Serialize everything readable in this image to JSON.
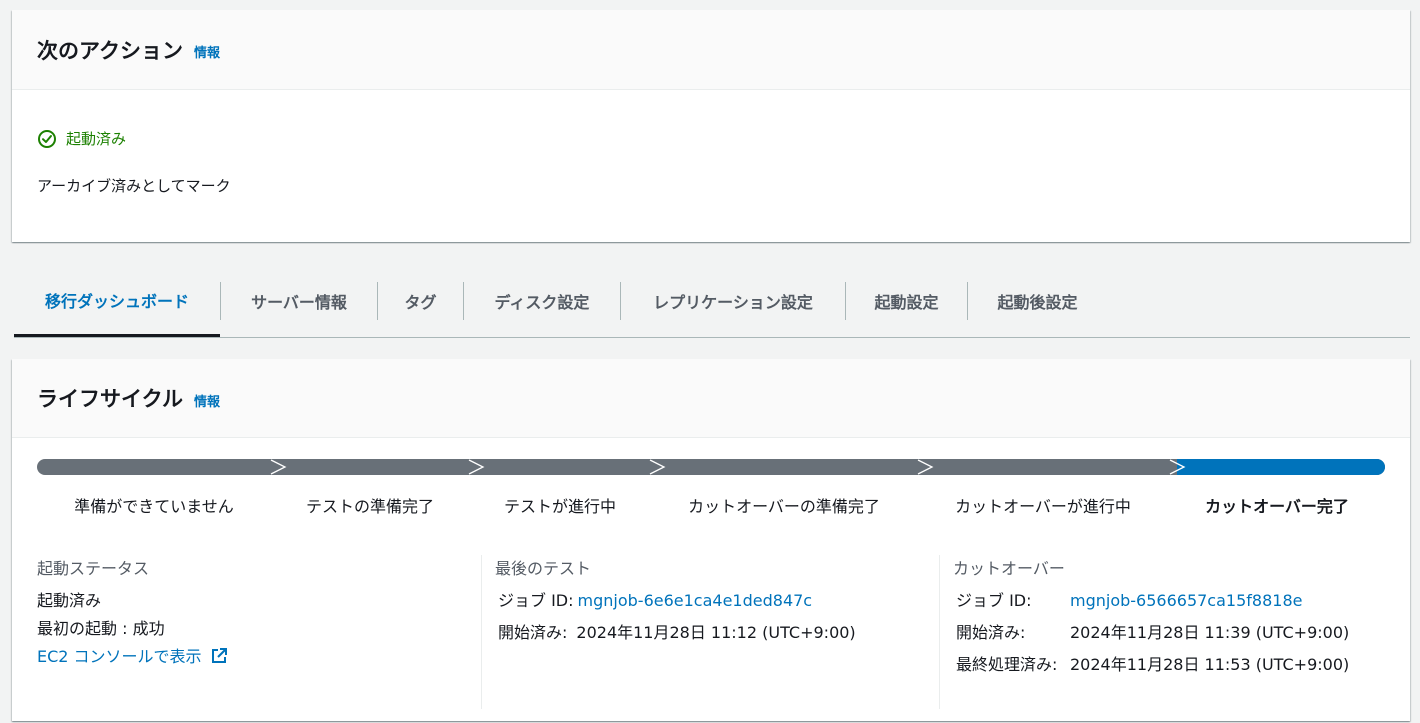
{
  "next_action": {
    "title": "次のアクション",
    "info": "情報",
    "status": "起動済み",
    "status_color": "#1d8102",
    "description": "アーカイブ済みとしてマーク"
  },
  "tabs": [
    {
      "label": "移行ダッシュボード",
      "active": true
    },
    {
      "label": "サーバー情報",
      "active": false
    },
    {
      "label": "タグ",
      "active": false
    },
    {
      "label": "ディスク設定",
      "active": false
    },
    {
      "label": "レプリケーション設定",
      "active": false
    },
    {
      "label": "起動設定",
      "active": false
    },
    {
      "label": "起動後設定",
      "active": false
    }
  ],
  "lifecycle": {
    "title": "ライフサイクル",
    "info": "情報",
    "steps": [
      {
        "label": "準備ができていません",
        "active": false
      },
      {
        "label": "テストの準備完了",
        "active": false
      },
      {
        "label": "テストが進行中",
        "active": false
      },
      {
        "label": "カットオーバーの準備完了",
        "active": false
      },
      {
        "label": "カットオーバーが進行中",
        "active": false
      },
      {
        "label": "カットオーバー完了",
        "active": true
      }
    ],
    "progress_colors": {
      "done": "#687078",
      "current": "#0073bb"
    },
    "launch_status": {
      "title": "起動ステータス",
      "status": "起動済み",
      "first_launch": "最初の起動 : 成功",
      "console_link": "EC2 コンソールで表示"
    },
    "last_test": {
      "title": "最後のテスト",
      "job_label": "ジョブ ID:",
      "job_id": "mgnjob-6e6e1ca4e1ded847c",
      "started_label": "開始済み:",
      "started_value": "2024年11月28日 11:12 (UTC+9:00)"
    },
    "cutover": {
      "title": "カットオーバー",
      "job_label": "ジョブ ID:",
      "job_id": "mgnjob-6566657ca15f8818e",
      "started_label": "開始済み:",
      "started_value": "2024年11月28日 11:39 (UTC+9:00)",
      "finalized_label": "最終処理済み:",
      "finalized_value": "2024年11月28日 11:53 (UTC+9:00)"
    }
  }
}
